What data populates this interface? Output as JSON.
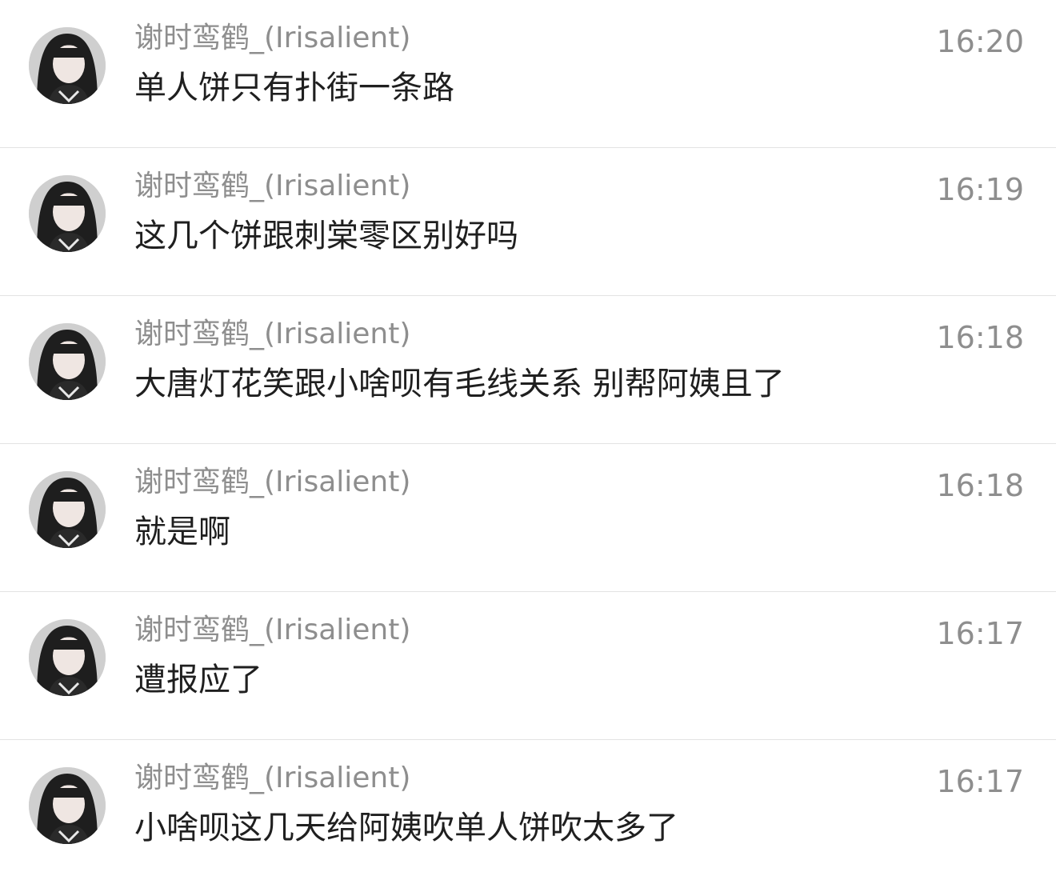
{
  "messages": [
    {
      "sender": "谢时鸾鹤_(Irisalient)",
      "text": "单人饼只有扑街一条路",
      "time": "16:20"
    },
    {
      "sender": "谢时鸾鹤_(Irisalient)",
      "text": "这几个饼跟刺棠零区别好吗",
      "time": "16:19"
    },
    {
      "sender": "谢时鸾鹤_(Irisalient)",
      "text": "大唐灯花笑跟小啥呗有毛线关系 别帮阿姨且了",
      "time": "16:18"
    },
    {
      "sender": "谢时鸾鹤_(Irisalient)",
      "text": "就是啊",
      "time": "16:18"
    },
    {
      "sender": "谢时鸾鹤_(Irisalient)",
      "text": "遭报应了",
      "time": "16:17"
    },
    {
      "sender": "谢时鸾鹤_(Irisalient)",
      "text": "小啥呗这几天给阿姨吹单人饼吹太多了",
      "time": "16:17"
    }
  ],
  "avatar_icon": "user-avatar-photo"
}
